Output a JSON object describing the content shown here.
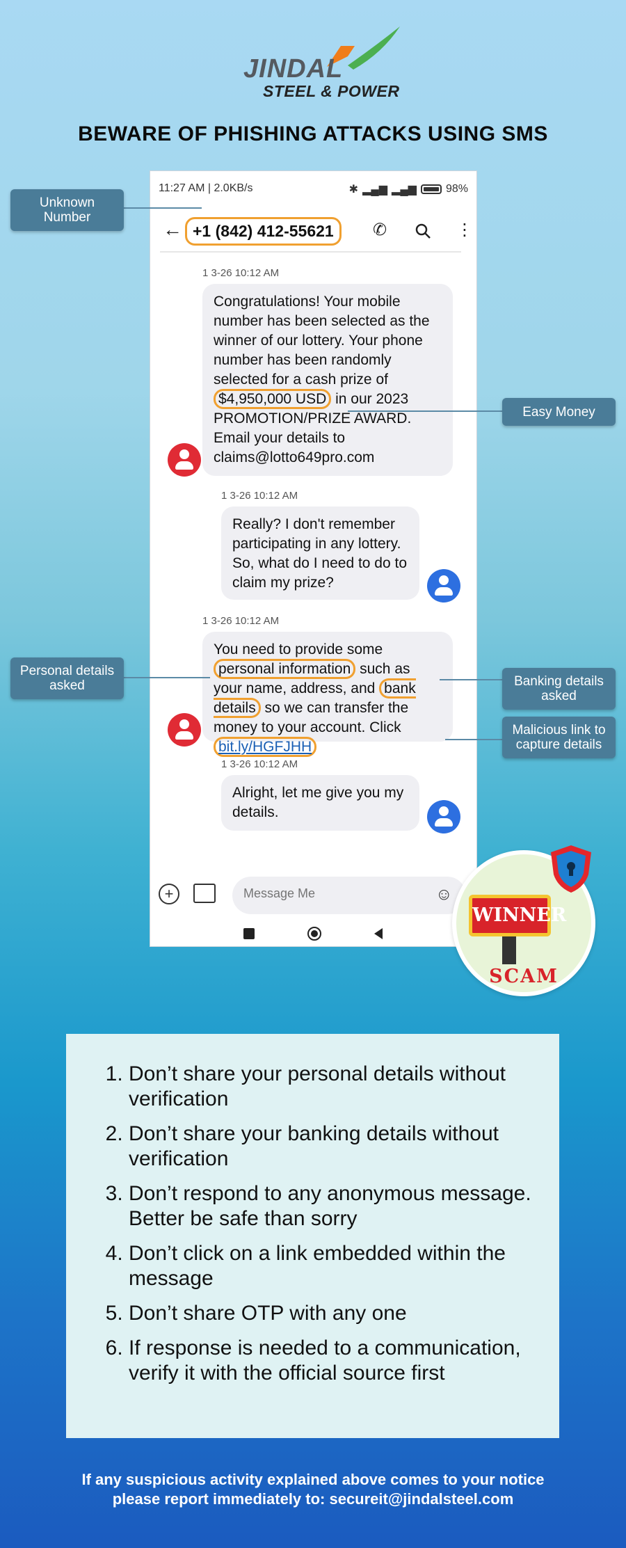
{
  "logo": {
    "line1": "JINDAL",
    "line2": "STEEL & POWER"
  },
  "headline": "BEWARE OF PHISHING ATTACKS USING SMS",
  "phone": {
    "status_time": "11:27 AM | 2.0KB/s",
    "battery": "98",
    "contact_number": "+1 (842) 412-55621",
    "messages": [
      {
        "timestamp": "1 3-26 10:12 AM",
        "sender": "unknown",
        "line1": "Congratulations! Your mobile number has been selected as the winner of our lottery. Your phone number has been randomly selected for a cash prize of",
        "amount": "$4,950,000 USD",
        "line2": "in our 2023 PROMOTION/PRIZE AWARD. Email your details to claims@lotto649pro.com"
      },
      {
        "timestamp": "1 3-26 10:12 AM",
        "sender": "me",
        "text": "Really? I don't remember participating in any lottery. So, what do I need to do to claim my prize?"
      },
      {
        "timestamp": "1 3-26 10:12 AM",
        "sender": "unknown",
        "pre": "You need to provide some",
        "personal": "personal information",
        "mid1": "such as your name, address, and",
        "bank": "bank details",
        "mid2": "so we can transfer the money to your account. Click",
        "link": "bit.ly/HGFJHH"
      },
      {
        "timestamp": "1 3-26 10:12 AM",
        "sender": "me",
        "text": "Alright, let me give you my details."
      }
    ],
    "compose_placeholder": "Message Me"
  },
  "callouts": {
    "unknown_number": "Unknown Number",
    "easy_money": "Easy Money",
    "personal_details": "Personal details asked",
    "banking_details": "Banking details asked",
    "malicious_link": "Malicious link to capture details"
  },
  "badge": {
    "winner": "WINNER",
    "scam": "SCAM"
  },
  "tips": [
    "Don’t share your personal details without verification",
    "Don’t share your banking details without verification",
    "Don’t respond to any anonymous message. Better be safe than sorry",
    "Don’t click on a link embedded within the message",
    "Don’t share OTP with any one",
    "If response is needed to a communication, verify it with the official source first"
  ],
  "footer": {
    "line1": "If any suspicious activity explained above comes to your notice",
    "line2": "please report immediately to: secureit@jindalsteel.com"
  },
  "colors": {
    "highlight": "#f0a030",
    "callout": "#4a7c98",
    "scam_red": "#d8232a",
    "brand_green": "#4caf50",
    "brand_orange": "#f07d1a"
  }
}
